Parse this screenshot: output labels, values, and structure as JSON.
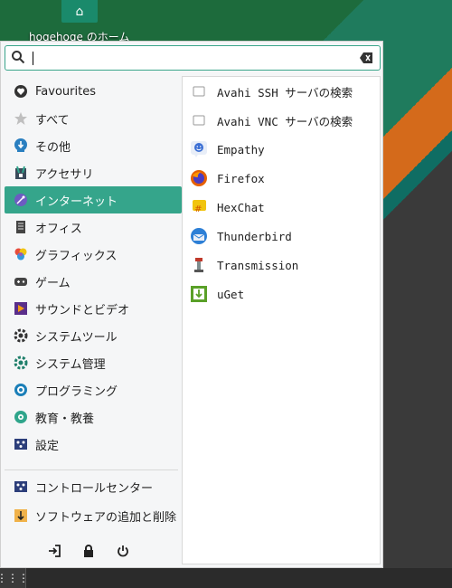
{
  "desktop": {
    "home_label": "hogehoge のホーム"
  },
  "search": {
    "placeholder": ""
  },
  "categories": [
    {
      "label": "Favourites",
      "icon": "heart-icon",
      "active": false
    },
    {
      "label": "すべて",
      "icon": "star-icon",
      "active": false
    },
    {
      "label": "その他",
      "icon": "other-icon",
      "active": false
    },
    {
      "label": "アクセサリ",
      "icon": "accessories-icon",
      "active": false
    },
    {
      "label": "インターネット",
      "icon": "internet-icon",
      "active": true
    },
    {
      "label": "オフィス",
      "icon": "office-icon",
      "active": false
    },
    {
      "label": "グラフィックス",
      "icon": "graphics-icon",
      "active": false
    },
    {
      "label": "ゲーム",
      "icon": "game-icon",
      "active": false
    },
    {
      "label": "サウンドとビデオ",
      "icon": "multimedia-icon",
      "active": false
    },
    {
      "label": "システムツール",
      "icon": "system-tools-icon",
      "active": false
    },
    {
      "label": "システム管理",
      "icon": "system-admin-icon",
      "active": false
    },
    {
      "label": "プログラミング",
      "icon": "programming-icon",
      "active": false
    },
    {
      "label": "教育・教養",
      "icon": "education-icon",
      "active": false
    },
    {
      "label": "設定",
      "icon": "settings-icon",
      "active": false
    }
  ],
  "bottom": [
    {
      "label": "コントロールセンター",
      "icon": "control-center-icon"
    },
    {
      "label": "ソフトウェアの追加と削除",
      "icon": "software-icon"
    }
  ],
  "apps": [
    {
      "label": "Avahi SSH サーバの検索",
      "icon": "avahi-ssh-icon"
    },
    {
      "label": "Avahi VNC サーバの検索",
      "icon": "avahi-vnc-icon"
    },
    {
      "label": "Empathy",
      "icon": "empathy-icon"
    },
    {
      "label": "Firefox",
      "icon": "firefox-icon"
    },
    {
      "label": "HexChat",
      "icon": "hexchat-icon"
    },
    {
      "label": "Thunderbird",
      "icon": "thunderbird-icon"
    },
    {
      "label": "Transmission",
      "icon": "transmission-icon"
    },
    {
      "label": "uGet",
      "icon": "uget-icon"
    }
  ],
  "colors": {
    "accent": "#35a58b"
  }
}
